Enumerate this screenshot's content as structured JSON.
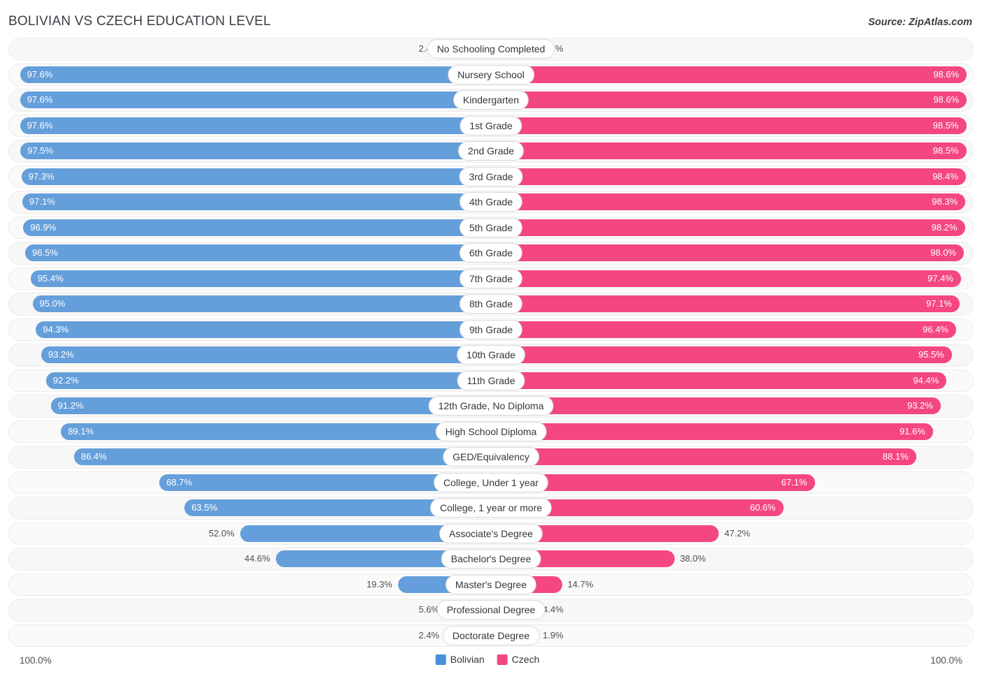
{
  "header": {
    "title": "BOLIVIAN VS CZECH EDUCATION LEVEL",
    "source": "Source: ZipAtlas.com"
  },
  "footer": {
    "axis_left": "100.0%",
    "axis_right": "100.0%",
    "legend": [
      {
        "label": "Bolivian",
        "color": "#4a90d9"
      },
      {
        "label": "Czech",
        "color": "#f4477f"
      }
    ]
  },
  "chart_data": {
    "type": "bar",
    "title": "BOLIVIAN VS CZECH EDUCATION LEVEL",
    "subtitle": "",
    "xlabel": "",
    "ylabel": "",
    "orientation": "horizontal-diverging",
    "grid": false,
    "legend_position": "bottom-center",
    "xlim": [
      0,
      100
    ],
    "axis_max_label": "100.0%",
    "categories": [
      "No Schooling Completed",
      "Nursery School",
      "Kindergarten",
      "1st Grade",
      "2nd Grade",
      "3rd Grade",
      "4th Grade",
      "5th Grade",
      "6th Grade",
      "7th Grade",
      "8th Grade",
      "9th Grade",
      "10th Grade",
      "11th Grade",
      "12th Grade, No Diploma",
      "High School Diploma",
      "GED/Equivalency",
      "College, Under 1 year",
      "College, 1 year or more",
      "Associate's Degree",
      "Bachelor's Degree",
      "Master's Degree",
      "Professional Degree",
      "Doctorate Degree"
    ],
    "series": [
      {
        "name": "Bolivian",
        "color": "#4a90d9",
        "values": [
          2.4,
          97.6,
          97.6,
          97.6,
          97.5,
          97.3,
          97.1,
          96.9,
          96.5,
          95.4,
          95.0,
          94.3,
          93.2,
          92.2,
          91.2,
          89.1,
          86.4,
          68.7,
          63.5,
          52.0,
          44.6,
          19.3,
          5.6,
          2.4
        ],
        "labels": [
          "2.4%",
          "97.6%",
          "97.6%",
          "97.6%",
          "97.5%",
          "97.3%",
          "97.1%",
          "96.9%",
          "96.5%",
          "95.4%",
          "95.0%",
          "94.3%",
          "93.2%",
          "92.2%",
          "91.2%",
          "89.1%",
          "86.4%",
          "68.7%",
          "63.5%",
          "52.0%",
          "44.6%",
          "19.3%",
          "5.6%",
          "2.4%"
        ]
      },
      {
        "name": "Czech",
        "color": "#f4477f",
        "values": [
          1.5,
          98.6,
          98.6,
          98.5,
          98.5,
          98.4,
          98.3,
          98.2,
          98.0,
          97.4,
          97.1,
          96.4,
          95.5,
          94.4,
          93.2,
          91.6,
          88.1,
          67.1,
          60.6,
          47.2,
          38.0,
          14.7,
          4.4,
          1.9
        ],
        "labels": [
          "1.5%",
          "98.6%",
          "98.6%",
          "98.5%",
          "98.5%",
          "98.4%",
          "98.3%",
          "98.2%",
          "98.0%",
          "97.4%",
          "97.1%",
          "96.4%",
          "95.5%",
          "94.4%",
          "93.2%",
          "91.6%",
          "88.1%",
          "67.1%",
          "60.6%",
          "47.2%",
          "38.0%",
          "14.7%",
          "4.4%",
          "1.9%"
        ]
      }
    ]
  }
}
